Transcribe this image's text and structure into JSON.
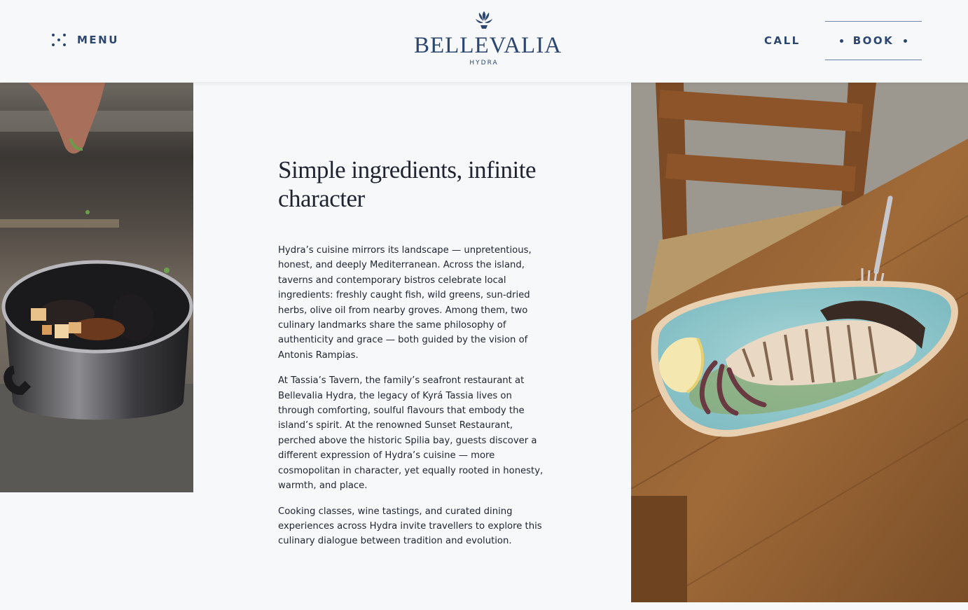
{
  "header": {
    "menu_label": "MENU",
    "logo_name": "BELLEVALIA",
    "logo_sub": "HYDRA",
    "call_label": "CALL",
    "book_label": "BOOK"
  },
  "images": {
    "left": "mussels-pot-being-garnished",
    "right": "grilled-squid-plate-on-wooden-table"
  },
  "article": {
    "title": "Simple ingredients, infinite character",
    "paragraphs": [
      "Hydra’s cuisine mirrors its landscape — unpretentious, honest, and deeply Mediterranean. Across the island, taverns and contemporary bistros celebrate local ingredients: freshly caught fish, wild greens, sun-dried herbs, olive oil from nearby groves. Among them, two culinary landmarks share the same philosophy of authenticity and grace — both guided by the vision of Antonis Rampias.",
      "At Tassia’s Tavern, the family’s seafront restaurant at Bellevalia Hydra, the legacy of Kyrá Tassia lives on through comforting, soulful flavours that embody the island’s spirit. At the renowned Sunset Restaurant, perched above the historic Spilia bay, guests discover a different expression of Hydra’s cuisine — more cosmopolitan in character, yet equally rooted in honesty, warmth, and place.",
      "Cooking classes, wine tastings, and curated dining experiences across Hydra invite travellers to explore this culinary dialogue between tradition and evolution."
    ]
  },
  "colors": {
    "brand": "#2c4670",
    "background": "#f6f8fa",
    "text": "#1f2430"
  }
}
